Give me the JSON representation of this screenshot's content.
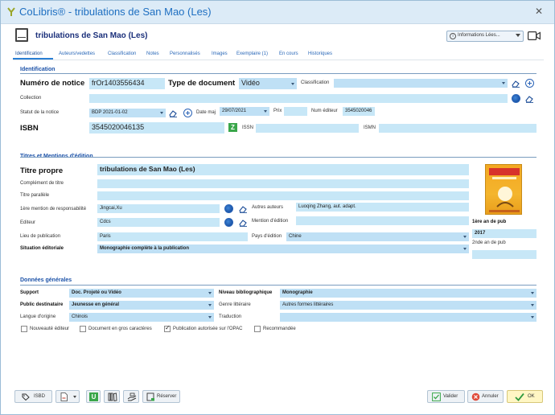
{
  "window": {
    "app_title": "CoLibris® -  tribulations de San Mao (Les)",
    "record_title": "tribulations de San Mao (Les)",
    "info_selector": "Informations Lées..."
  },
  "tabs": [
    "Identification",
    "Auteurs/vedettes",
    "Classification",
    "Notes",
    "Personnalisés",
    "Images",
    "Exemplaire (1)",
    "En cours",
    "Historiques"
  ],
  "identification": {
    "section_title": "Identification",
    "numero_label": "Numéro de notice",
    "numero_value": "frOr1403556434",
    "type_label": "Type de document",
    "type_value": "Vidéo",
    "classification_label": "Classification",
    "classification_value": "",
    "collection_label": "Collection",
    "collection_value": "",
    "statut_label": "Statut de la notice",
    "statut_value": "BDP 2021-01-02",
    "date_maj_label": "Date maj",
    "date_maj_value": "29/07/2021",
    "prix_label": "Prix",
    "prix_value": "",
    "num_editeur_label": "Num éditeur",
    "num_editeur_value": "3545020046",
    "isbn_label": "ISBN",
    "isbn_value": "3545020046135",
    "issn_label": "ISSN",
    "issn_value": "",
    "ismn_label": "ISMN",
    "ismn_value": ""
  },
  "titres": {
    "section_title": "Titres et Mentions d'édition",
    "titre_propre_label": "Titre propre",
    "titre_propre_value": "tribulations de San Mao (Les)",
    "complement_label": "Complément de titre",
    "complement_value": "",
    "parallele_label": "Titre parallèle",
    "parallele_value": "",
    "resp_label": "1ère mention de responsabilité",
    "resp_value": "Jingcai,Xu",
    "autres_auteurs_label": "Autres auteurs",
    "autres_auteurs_value": "Luoqing Zhang, aut. adapt.",
    "editeur_label": "Editeur",
    "editeur_value": "Cdcs",
    "mention_label": "Mention d'édition",
    "mention_value": "",
    "lieu_label": "Lieu de publication",
    "lieu_value": "Paris",
    "pays_label": "Pays d'édition",
    "pays_value": "Chine",
    "situation_label": "Situation éditoriale",
    "situation_value": "Monographie complète à la publication",
    "pub1_label": "1ère an de pub",
    "pub1_value": "2017",
    "pub2_label": "2nde an de pub",
    "pub2_value": ""
  },
  "donnees": {
    "section_title": "Données générales",
    "support_label": "Support",
    "support_value": "Doc. Projeté ou Vidéo",
    "niveau_label": "Niveau bibliographique",
    "niveau_value": "Monographie",
    "public_label": "Public destinataire",
    "public_value": "Jeunesse en général",
    "genre_label": "Genre littéraire",
    "genre_value": "Autres formes littéraires",
    "langue_label": "Langue d'origine",
    "langue_value": "Chinois",
    "traduction_label": "Traduction",
    "traduction_value": "",
    "checkboxes": [
      {
        "label": "Nouveauté éditeur",
        "checked": false
      },
      {
        "label": "Document en gros caractères",
        "checked": false
      },
      {
        "label": "Publication autorisée sur l'OPAC",
        "checked": true
      },
      {
        "label": "Recommandée",
        "checked": false
      }
    ]
  },
  "footer": {
    "isbd": "ISBD",
    "reserver": "Réserver",
    "valider": "Valider",
    "annuler": "Annuler",
    "ok": "OK"
  },
  "colors": {
    "accent": "#1e6fc1",
    "field_bg": "#c7e7f7",
    "section_title": "#1c52a8"
  }
}
